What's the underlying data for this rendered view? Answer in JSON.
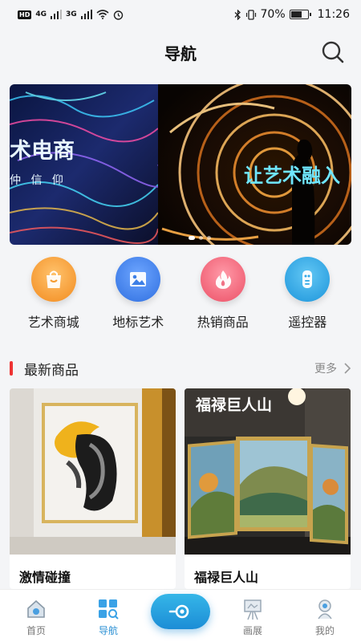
{
  "status_bar": {
    "hd": "HD",
    "net1": "4G",
    "net2": "3G",
    "battery_text": "70%",
    "battery_level": 0.7,
    "time": "11:26"
  },
  "header": {
    "title": "导航",
    "search_icon": "search-icon"
  },
  "banner": {
    "text_left_1": "术电商",
    "text_left_2": "仲 信 仰",
    "text_right": "让艺术融入",
    "slide_count": 3,
    "active_slide": 0
  },
  "quick_nav": [
    {
      "label": "艺术商城",
      "icon": "shopping-bag-icon",
      "color": "#f7a23a"
    },
    {
      "label": "地标艺术",
      "icon": "picture-icon",
      "color": "#3d7fe6"
    },
    {
      "label": "热销商品",
      "icon": "fire-icon",
      "color": "#f0637a"
    },
    {
      "label": "遥控器",
      "icon": "remote-control-icon",
      "color": "#2ea7e6"
    }
  ],
  "section": {
    "title": "最新商品",
    "more": "更多"
  },
  "products": [
    {
      "title": "激情碰撞"
    },
    {
      "title": "福禄巨人山",
      "overlay": "福禄巨人山"
    }
  ],
  "bottom_nav": {
    "items": [
      {
        "label": "首页",
        "icon": "home-icon",
        "active": false
      },
      {
        "label": "导航",
        "icon": "grid-search-icon",
        "active": true
      },
      {
        "label": "画展",
        "icon": "easel-icon",
        "active": false
      },
      {
        "label": "我的",
        "icon": "profile-icon",
        "active": false
      }
    ],
    "center_icon": "eye-icon"
  },
  "colors": {
    "accent": "#2a8fd3",
    "section_bar": "#ee3333",
    "background": "#f4f5f7"
  }
}
